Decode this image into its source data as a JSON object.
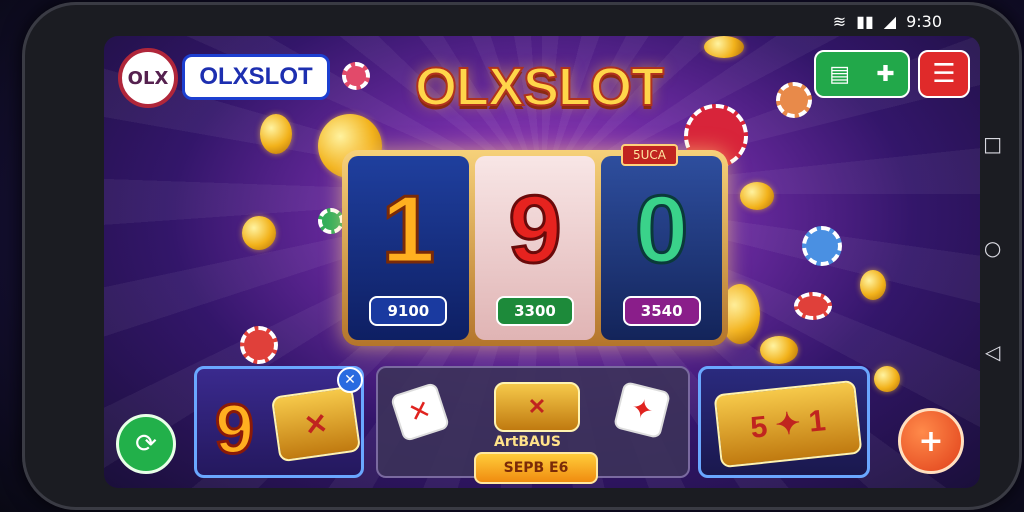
{
  "status_bar": {
    "time": "9:30",
    "wifi_icon": "wifi-icon",
    "signal_icon": "signal-icon"
  },
  "header": {
    "logo_text": "OLX",
    "brand_label": "OLXSLOT",
    "title": "OLXSLOT"
  },
  "top_right": {
    "grid_icon": "grid-icon",
    "plus_icon": "gamepad-icon",
    "menu_icon": "menu-icon"
  },
  "slot": {
    "tag": "5UCA",
    "reels": [
      {
        "digit": "1",
        "badge": "9100"
      },
      {
        "digit": "9",
        "badge": "3300"
      },
      {
        "digit": "0",
        "badge": "3540"
      }
    ]
  },
  "cards": {
    "left": {
      "number": "9",
      "close": "✕"
    },
    "middle": {
      "label": "ArtBAUS",
      "button": "SEPB E6"
    },
    "right": {}
  },
  "controls": {
    "left_round": "⟳",
    "right_round": "+"
  },
  "nav": {
    "back": "◁",
    "home": "○",
    "recent": "□"
  },
  "colors": {
    "accent": "#ffd64a",
    "green": "#22a84a",
    "red": "#e02a2a",
    "brand_blue": "#1d3fd0"
  }
}
